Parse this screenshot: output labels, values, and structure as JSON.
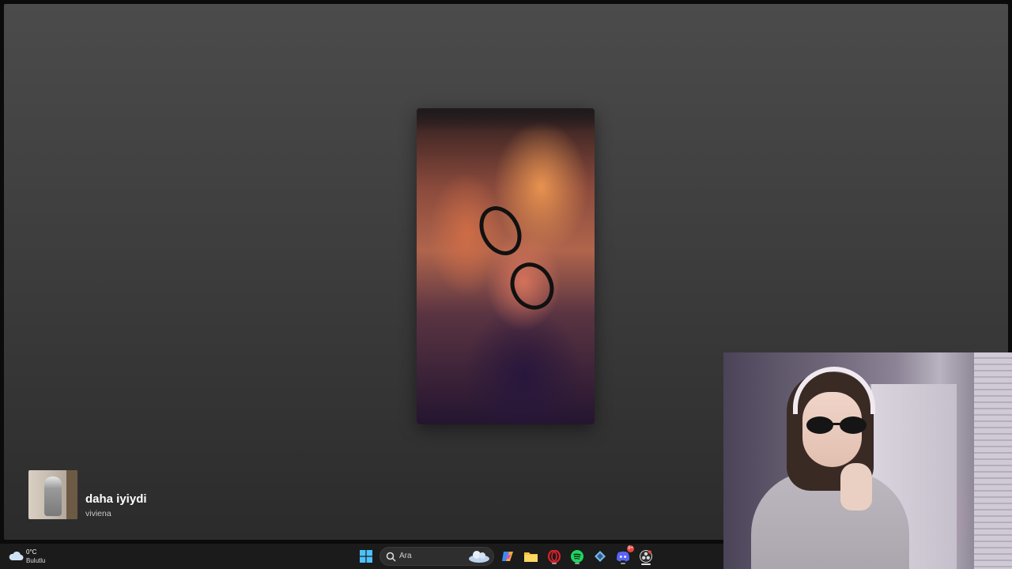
{
  "now_playing": {
    "title": "daha iyiydi",
    "artist": "viviena"
  },
  "taskbar": {
    "weather": {
      "temperature": "0°C",
      "condition": "Bulutlu",
      "icon": "cloud-icon"
    },
    "search": {
      "placeholder": "Ara"
    },
    "apps": [
      {
        "name": "start",
        "icon": "windows-logo-icon"
      },
      {
        "name": "copilot",
        "icon": "copilot-icon"
      },
      {
        "name": "file-explorer",
        "icon": "folder-icon"
      },
      {
        "name": "opera",
        "icon": "opera-icon"
      },
      {
        "name": "spotify",
        "icon": "spotify-icon"
      },
      {
        "name": "app",
        "icon": "diamond-app-icon"
      },
      {
        "name": "discord",
        "icon": "discord-icon",
        "badge": "9+"
      },
      {
        "name": "obs",
        "icon": "obs-icon"
      }
    ]
  },
  "colors": {
    "window_bg_top": "#4b4b4b",
    "window_bg_bottom": "#2b2b2b",
    "taskbar_bg": "#1b1b1b",
    "spotify_green": "#1ed760",
    "opera_red": "#e0202c",
    "discord_blurple": "#5865f2"
  }
}
